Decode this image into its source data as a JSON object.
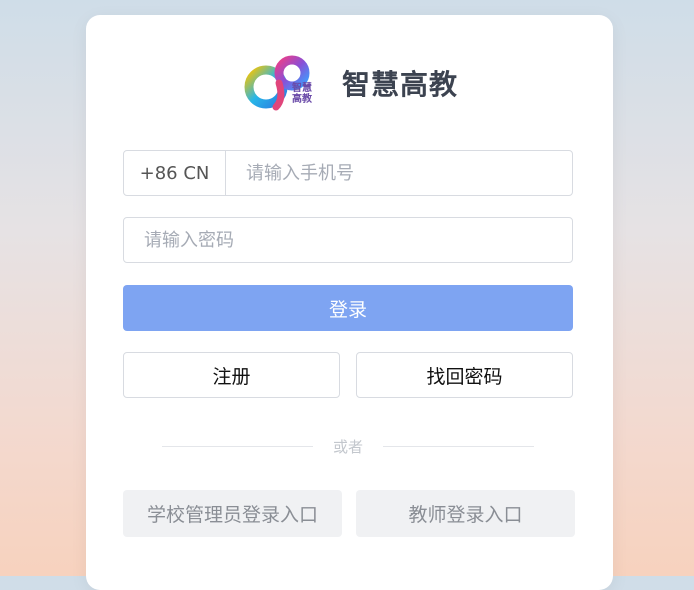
{
  "brand": {
    "name": "智慧高教",
    "logo_text": "智慧高教",
    "logo_icon": "infinity-logo-icon"
  },
  "phone": {
    "country_code": "+86 CN",
    "placeholder": "请输入手机号"
  },
  "password": {
    "placeholder": "请输入密码"
  },
  "buttons": {
    "login": "登录",
    "register": "注册",
    "find_password": "找回密码",
    "admin_entry": "学校管理员登录入口",
    "teacher_entry": "教师登录入口"
  },
  "divider": {
    "text": "或者"
  },
  "colors": {
    "primary": "#7ea4f2",
    "border": "#d8dbe1",
    "gray_button": "#f0f1f3"
  }
}
